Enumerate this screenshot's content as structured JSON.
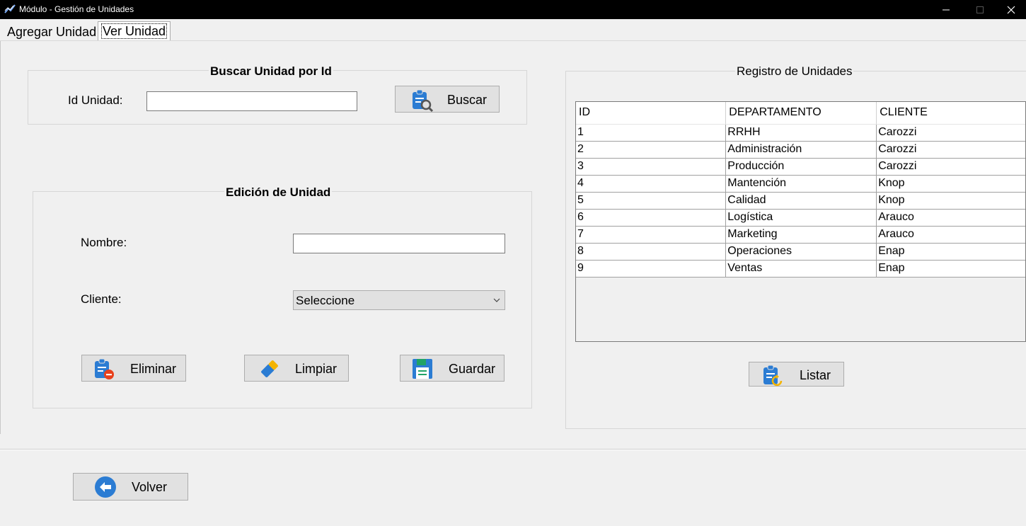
{
  "window": {
    "title": "Módulo - Gestión de Unidades"
  },
  "tabs": [
    {
      "label": "Agregar Unidad"
    },
    {
      "label": "Ver Unidad"
    }
  ],
  "search_group": {
    "title": "Buscar Unidad por Id",
    "id_label": "Id Unidad:",
    "id_value": "",
    "search_button": "Buscar"
  },
  "edit_group": {
    "title": "Edición de Unidad",
    "name_label": "Nombre:",
    "name_value": "",
    "client_label": "Cliente:",
    "client_selected": "Seleccione",
    "delete_button": "Eliminar",
    "clear_button": "Limpiar",
    "save_button": "Guardar"
  },
  "registry": {
    "title": "Registro de Unidades",
    "columns": [
      "ID",
      "DEPARTAMENTO",
      "CLIENTE"
    ],
    "rows": [
      [
        "1",
        "RRHH",
        "Carozzi"
      ],
      [
        "2",
        "Administración",
        "Carozzi"
      ],
      [
        "3",
        "Producción",
        "Carozzi"
      ],
      [
        "4",
        "Mantención",
        "Knop"
      ],
      [
        "5",
        "Calidad",
        "Knop"
      ],
      [
        "6",
        "Logística",
        "Arauco"
      ],
      [
        "7",
        "Marketing",
        "Arauco"
      ],
      [
        "8",
        "Operaciones",
        "Enap"
      ],
      [
        "9",
        "Ventas",
        "Enap"
      ]
    ],
    "list_button": "Listar"
  },
  "footer": {
    "back_button": "Volver"
  },
  "colors": {
    "icon_blue": "#2b7cd3",
    "icon_red": "#e8401c",
    "icon_yellow": "#f4b400",
    "icon_green": "#21a366"
  }
}
